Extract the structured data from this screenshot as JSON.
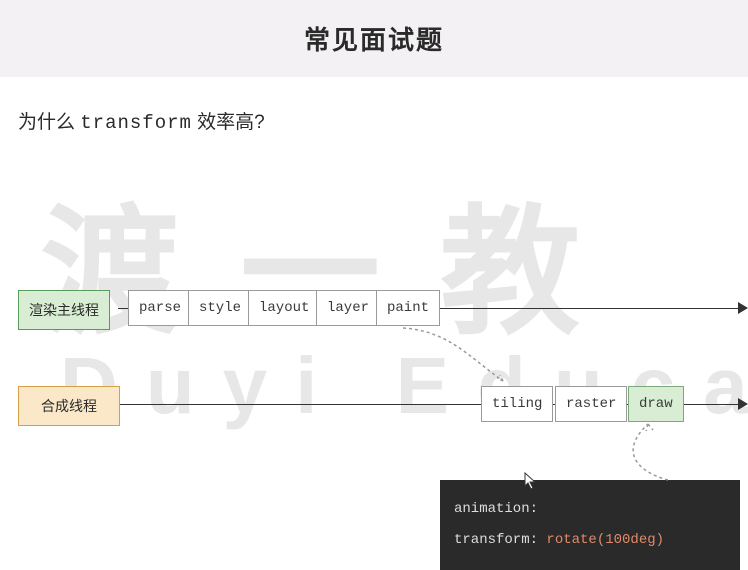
{
  "header": {
    "title": "常见面试题"
  },
  "question": {
    "prefix": "为什么 ",
    "code": "transform",
    "suffix": " 效率高?"
  },
  "watermark": {
    "cn": "渡一教",
    "en": "Duyi Educati"
  },
  "rows": {
    "main": {
      "label": "渲染主线程",
      "steps": [
        "parse",
        "style",
        "layout",
        "layer",
        "paint"
      ]
    },
    "compositor": {
      "label": "合成线程",
      "steps": [
        "tiling",
        "raster",
        "draw"
      ]
    }
  },
  "code": {
    "line1_key": "animation:",
    "line2_key": "transform:",
    "line2_val": "rotate(100deg)"
  }
}
